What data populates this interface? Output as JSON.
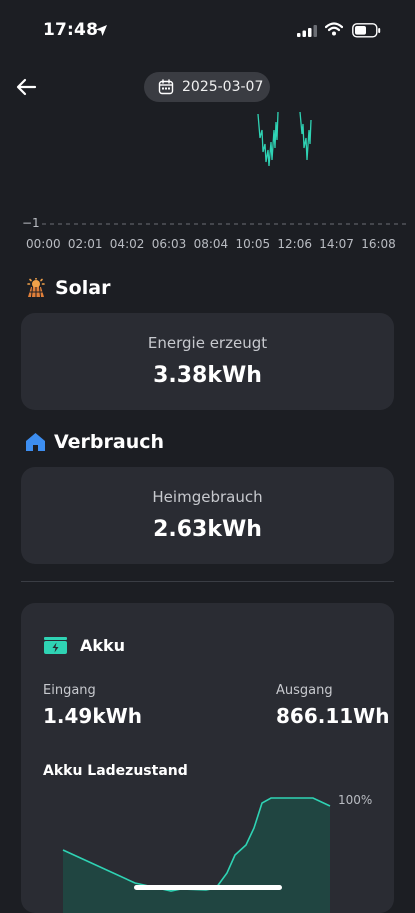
{
  "status_bar": {
    "time": "17:48"
  },
  "header": {
    "date": "2025-03-07"
  },
  "power_chart": {
    "y_tick": "−1",
    "x_ticks": [
      "00:00",
      "02:01",
      "04:02",
      "06:03",
      "08:04",
      "10:05",
      "12:06",
      "14:07",
      "16:08"
    ]
  },
  "solar": {
    "title": "Solar",
    "label": "Energie erzeugt",
    "value": "3.38kWh"
  },
  "consumption": {
    "title": "Verbrauch",
    "label": "Heimgebrauch",
    "value": "2.63kWh"
  },
  "battery": {
    "title": "Akku",
    "input_label": "Eingang",
    "input_value": "1.49kWh",
    "output_label": "Ausgang",
    "output_value": "866.11Wh",
    "soc_title": "Akku Ladezustand",
    "soc_max_label": "100%"
  },
  "colors": {
    "accent": "#2fd3b4",
    "background": "#1c1e23",
    "card": "#2a2c33",
    "house": "#3d8ef0",
    "solar": "#f0a14a"
  }
}
